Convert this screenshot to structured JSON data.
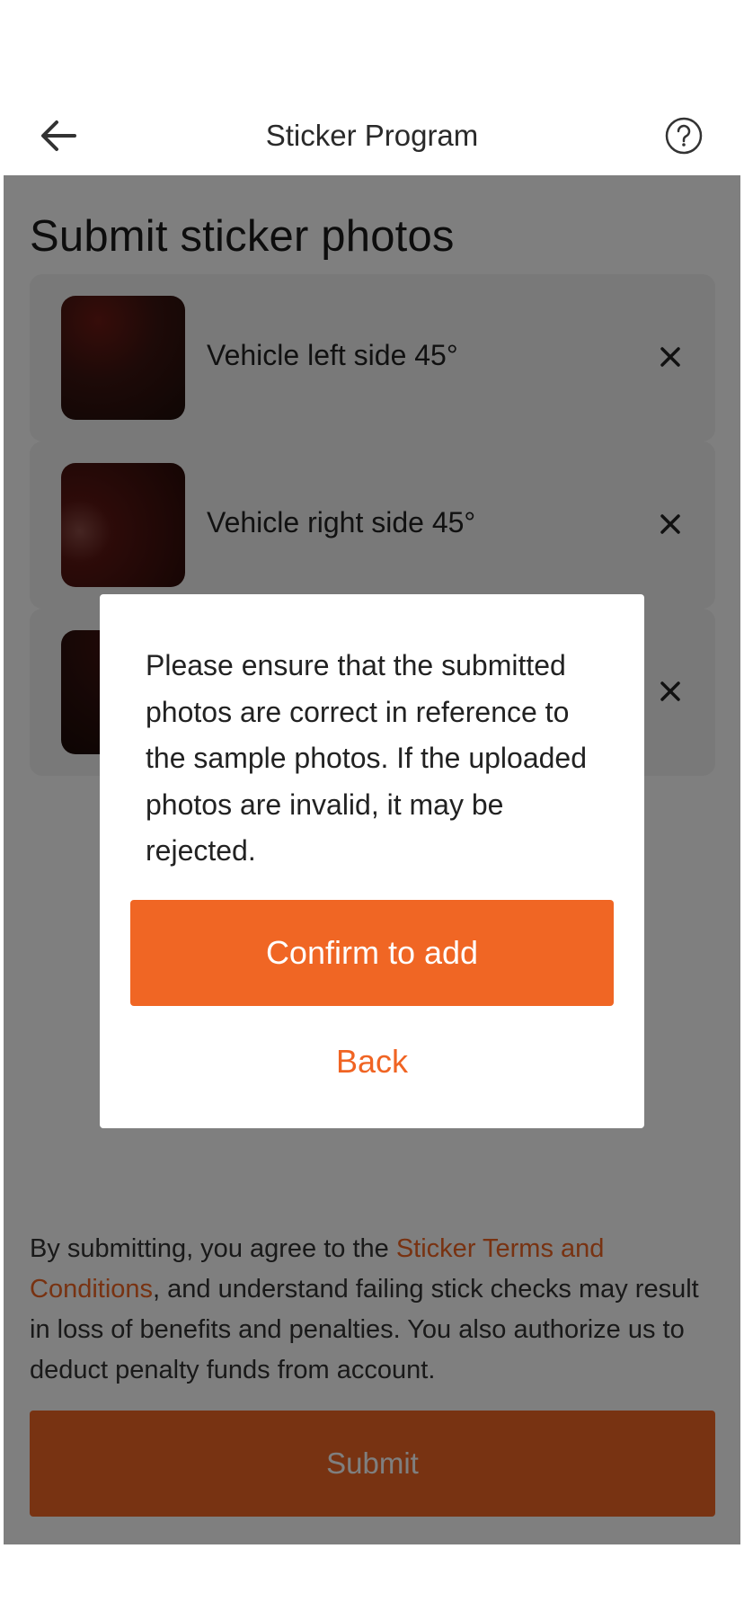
{
  "nav": {
    "title": "Sticker Program",
    "back_icon": "arrow-left-icon",
    "help_icon": "question-circle-icon"
  },
  "main": {
    "title": "Submit sticker photos",
    "photos": [
      {
        "label": "Vehicle left side 45°"
      },
      {
        "label": "Vehicle right side 45°"
      },
      {
        "label": ""
      }
    ],
    "remove_icon": "close-icon",
    "terms": {
      "prefix": "By submitting, you agree to the ",
      "link": "Sticker Terms and Conditions",
      "suffix": ", and understand failing stick checks may result in loss of benefits and penalties. You also authorize us to deduct penalty funds from account."
    },
    "submit_label": "Submit"
  },
  "modal": {
    "message": "Please ensure that the submitted photos are correct in reference to the sample photos. If the uploaded photos are invalid, it may be rejected.",
    "confirm_label": "Confirm to add",
    "back_label": "Back"
  },
  "colors": {
    "accent": "#f06624",
    "link": "#f06423",
    "overlay": "rgba(0,0,0,0.5)"
  }
}
